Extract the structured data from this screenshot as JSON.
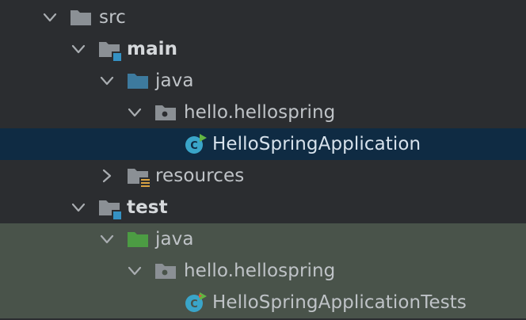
{
  "tree": {
    "src": {
      "label": "src",
      "expanded": true,
      "icon": "folder-icon"
    },
    "main": {
      "label": "main",
      "expanded": true,
      "icon": "source-root-folder-icon"
    },
    "main_java": {
      "label": "java",
      "expanded": true,
      "icon": "sources-folder-icon"
    },
    "main_package": {
      "label": "hello.hellospring",
      "expanded": true,
      "icon": "package-icon"
    },
    "main_class": {
      "label": "HelloSpringApplication",
      "selected": true,
      "icon": "spring-class-icon"
    },
    "resources": {
      "label": "resources",
      "expanded": false,
      "icon": "resources-folder-icon"
    },
    "test": {
      "label": "test",
      "expanded": true,
      "icon": "source-root-folder-icon"
    },
    "test_java": {
      "label": "java",
      "expanded": true,
      "icon": "test-sources-folder-icon"
    },
    "test_package": {
      "label": "hello.hellospring",
      "expanded": true,
      "icon": "package-icon"
    },
    "test_class": {
      "label": "HelloSpringApplicationTests",
      "icon": "spring-class-icon"
    }
  },
  "colors": {
    "background": "#2b2d30",
    "selection": "#0f2b43",
    "test_highlight": "#49534a",
    "folder_gray": "#8b9095",
    "java_blue": "#3d7a9e",
    "test_green": "#4c9c43",
    "class_cyan": "#3aa5c9",
    "spring_green": "#62b543",
    "root_marker": "#3592c4",
    "resource_marker": "#d9a343"
  }
}
